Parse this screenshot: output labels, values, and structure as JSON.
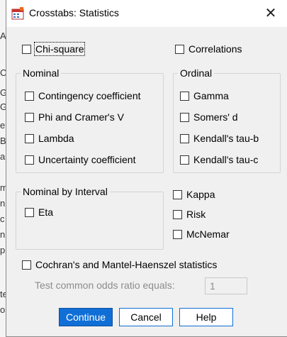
{
  "window": {
    "title": "Crosstabs: Statistics",
    "close_glyph": "✕"
  },
  "top_options": {
    "chi_square": "Chi-square",
    "correlations": "Correlations"
  },
  "nominal": {
    "title": "Nominal",
    "items": [
      "Contingency coefficient",
      "Phi and Cramer's V",
      "Lambda",
      "Uncertainty coefficient"
    ]
  },
  "ordinal": {
    "title": "Ordinal",
    "items": [
      "Gamma",
      "Somers' d",
      "Kendall's tau-b",
      "Kendall's tau-c"
    ]
  },
  "nominal_by_interval": {
    "title": "Nominal by Interval",
    "items": [
      "Eta"
    ]
  },
  "other": {
    "items": [
      "Kappa",
      "Risk",
      "McNemar"
    ]
  },
  "cmh": {
    "label": "Cochran's and Mantel-Haenszel statistics",
    "odds_label": "Test common odds ratio equals:",
    "odds_value": "1"
  },
  "buttons": {
    "continue": "Continue",
    "cancel": "Cancel",
    "help": "Help"
  },
  "underlay": {
    "letters": [
      "A",
      "",
      "C",
      "G",
      "G",
      "e",
      "B",
      "a",
      "",
      "m",
      "n",
      "c",
      "n",
      "p",
      "or",
      "o",
      "n",
      "",
      "te",
      "o"
    ]
  },
  "colors": {
    "accent": "#0f6fd6",
    "dialog_bg": "#f0f0f0",
    "disabled_text": "#8c8c8c"
  },
  "icons": {
    "app": "spss-crosstabs-icon",
    "close": "close-icon"
  }
}
